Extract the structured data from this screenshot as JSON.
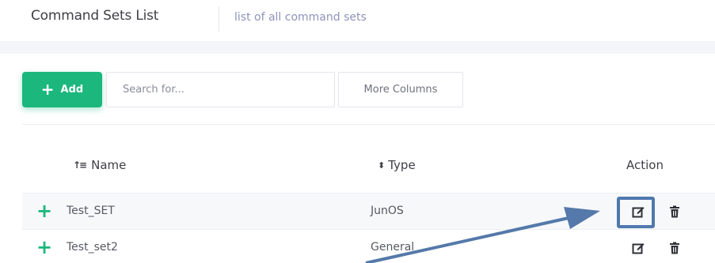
{
  "header": {
    "title": "Command Sets List",
    "subtitle": "list of all command sets"
  },
  "toolbar": {
    "add_label": "Add",
    "search_placeholder": "Search for...",
    "more_columns_label": "More Columns"
  },
  "table": {
    "columns": {
      "name": "Name",
      "type": "Type",
      "action": "Action"
    },
    "rows": [
      {
        "name": "Test_SET",
        "type": "JunOS"
      },
      {
        "name": "Test_set2",
        "type": "General"
      }
    ]
  },
  "colors": {
    "accent_green": "#1bb77c",
    "highlight_blue": "#4e79ad",
    "subtitle": "#8f93ba"
  },
  "icons": {
    "add": "plus-icon",
    "sort_name": "sort-ascending-icon",
    "sort_type": "sort-icon",
    "expand": "plus-icon",
    "edit": "edit-icon",
    "delete": "trash-icon"
  }
}
